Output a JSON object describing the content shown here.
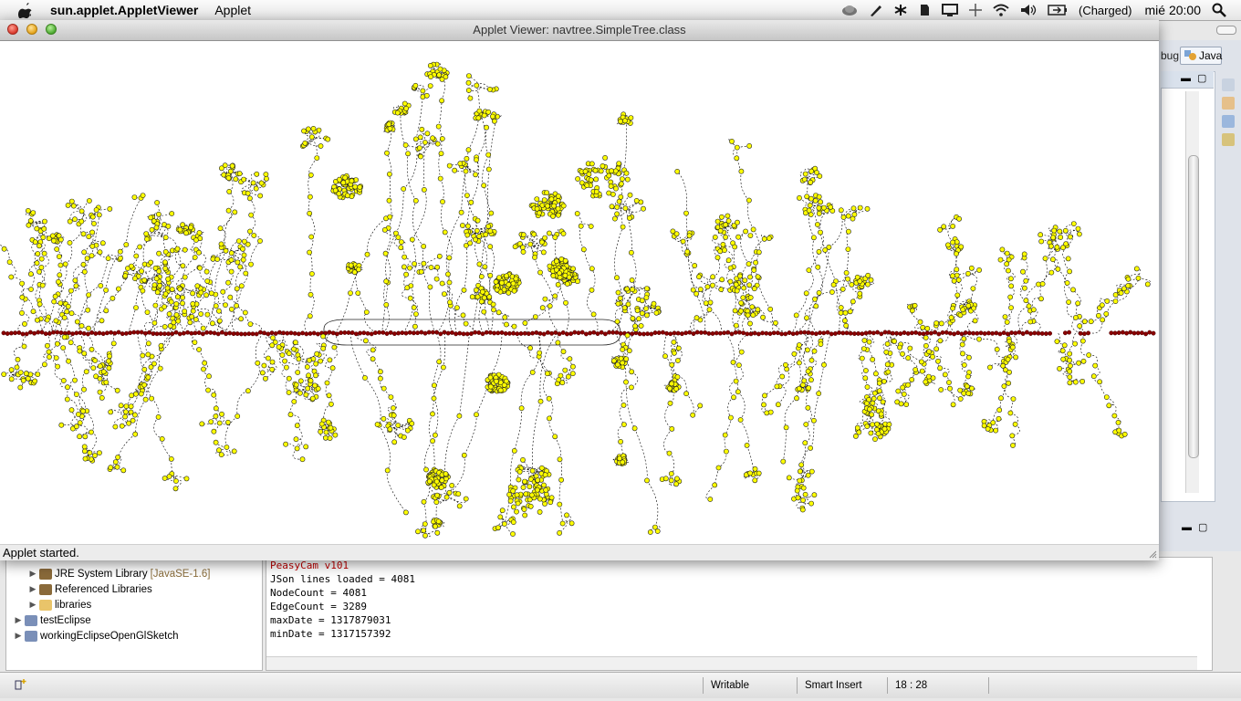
{
  "menubar": {
    "app_name": "sun.applet.AppletViewer",
    "menu_applet": "Applet",
    "battery_text": "(Charged)",
    "clock": "mié 20:00"
  },
  "applet_window": {
    "title": "Applet Viewer: navtree.SimpleTree.class",
    "status": "Applet started."
  },
  "eclipse": {
    "perspective_partial": "bug",
    "perspective_java": "Java",
    "package_tree": [
      {
        "label": "JRE System Library",
        "suffix": "[JavaSE-1.6]",
        "indent": 1,
        "icon": "library-icon"
      },
      {
        "label": "Referenced Libraries",
        "suffix": "",
        "indent": 1,
        "icon": "library-icon"
      },
      {
        "label": "libraries",
        "suffix": "",
        "indent": 1,
        "icon": "folder-icon"
      },
      {
        "label": "testEclipse",
        "suffix": "",
        "indent": 0,
        "icon": "project-icon"
      },
      {
        "label": "workingEclipseOpenGlSketch",
        "suffix": "",
        "indent": 0,
        "icon": "project-icon"
      }
    ],
    "console_lines": [
      {
        "text": "PeasyCam v101",
        "color": "#c00000"
      },
      {
        "text": "JSon lines loaded = 4081",
        "color": "#000000"
      },
      {
        "text": "NodeCount = 4081",
        "color": "#000000"
      },
      {
        "text": "EdgeCount = 3289",
        "color": "#000000"
      },
      {
        "text": "maxDate = 1317879031",
        "color": "#000000"
      },
      {
        "text": "minDate = 1317157392",
        "color": "#000000"
      }
    ],
    "status_bar": {
      "writable": "Writable",
      "insert_mode": "Smart Insert",
      "position": "18 : 28"
    }
  },
  "graph": {
    "node_color": "#ffff00",
    "axis_node_color": "#8b0000",
    "edge_color": "#000000"
  }
}
